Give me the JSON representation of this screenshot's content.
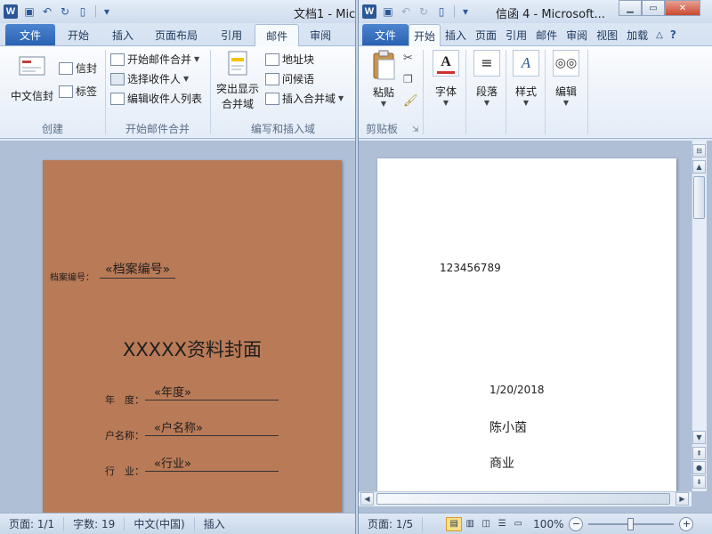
{
  "left_window": {
    "title": "文档1 - Mic",
    "tabs": [
      "文件",
      "开始",
      "插入",
      "页面布局",
      "引用",
      "邮件",
      "审阅"
    ],
    "active_tab": "邮件",
    "ribbon": {
      "create_group": {
        "label": "创建",
        "chinese_envelope": "中文信封",
        "envelope": "信封",
        "labels": "标签"
      },
      "merge_group": {
        "label": "开始邮件合并",
        "start_merge": "开始邮件合并",
        "select_recipients": "选择收件人",
        "edit_recipients": "编辑收件人列表"
      },
      "write_group": {
        "label": "编写和插入域",
        "highlight_fields_line1": "突出显示",
        "highlight_fields_line2": "合并域",
        "address_block": "地址块",
        "greeting": "问候语",
        "insert_field": "插入合并域"
      }
    },
    "document": {
      "file_no_label": "档案编号：",
      "file_no_field": "«档案编号»",
      "cover_title": "XXXXX资料封面",
      "year_label": "年　度：",
      "year_field": "«年度»",
      "account_label": "户名称：",
      "account_field": "«户名称»",
      "industry_label": "行　业：",
      "industry_field": "«行业»"
    },
    "status": {
      "page": "页面: 1/1",
      "words": "字数: 19",
      "language": "中文(中国)",
      "mode": "插入"
    }
  },
  "right_window": {
    "title": "信函 4 - Microsoft...",
    "tabs": [
      "文件",
      "开始",
      "插入",
      "页面",
      "引用",
      "邮件",
      "审阅",
      "视图",
      "加载"
    ],
    "active_tab": "开始",
    "ribbon": {
      "clipboard_label": "剪贴板",
      "paste": "粘贴",
      "font": "字体",
      "paragraph": "段落",
      "styles": "样式",
      "editing": "编辑"
    },
    "document": {
      "file_no": "123456789",
      "date": "1/20/2018",
      "name": "陈小茵",
      "industry": "商业"
    },
    "status": {
      "page": "页面: 1/5",
      "zoom": "100%"
    }
  },
  "colors": {
    "cover_page": "#b97a57",
    "file_tab": "#2a62b3"
  }
}
